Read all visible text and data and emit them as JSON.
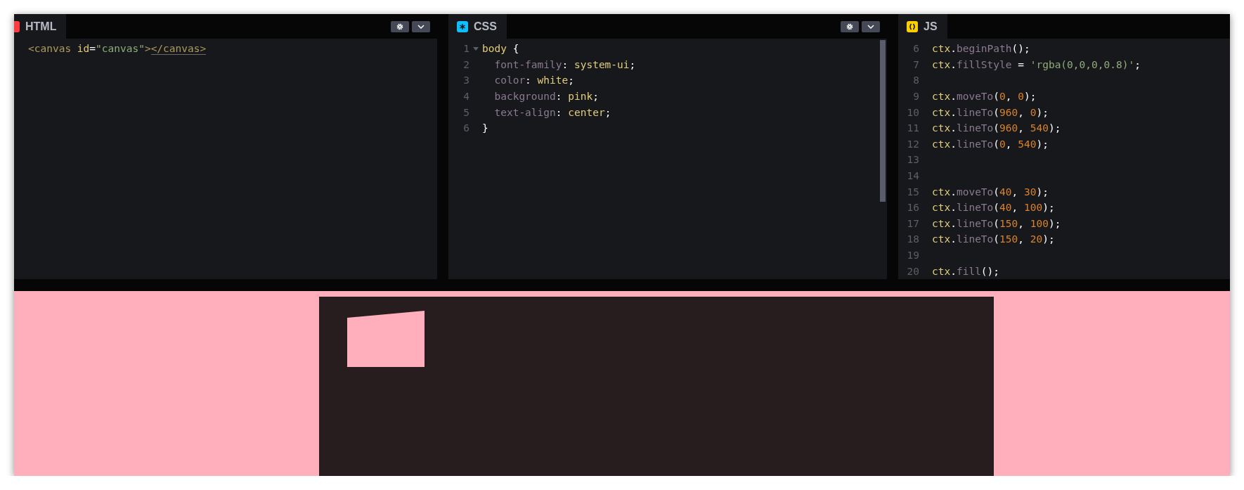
{
  "panels": [
    {
      "tab": {
        "label": "HTML",
        "kind": "html"
      },
      "controls": true,
      "scrollbar": false,
      "lines": [
        {
          "tokens": [
            {
              "text": "<canvas",
              "kind": "tag"
            },
            {
              "text": " id",
              "kind": "attr"
            },
            {
              "text": "=",
              "kind": "punc"
            },
            {
              "text": "\"canvas\"",
              "kind": "string"
            },
            {
              "text": ">",
              "kind": "tag"
            },
            {
              "text": "</canvas>",
              "kind": "tag",
              "matched": true
            }
          ]
        }
      ]
    },
    {
      "tab": {
        "label": "CSS",
        "kind": "css"
      },
      "controls": true,
      "scrollbar": true,
      "lines": [
        {
          "number": "1",
          "foldable": true,
          "tokens": [
            {
              "text": "body",
              "kind": "value"
            },
            {
              "text": " {",
              "kind": "punc"
            }
          ]
        },
        {
          "number": "2",
          "tokens": [
            {
              "text": "  font-family",
              "kind": "prop"
            },
            {
              "text": ": ",
              "kind": "punc"
            },
            {
              "text": "system-ui",
              "kind": "value"
            },
            {
              "text": ";",
              "kind": "punc"
            }
          ]
        },
        {
          "number": "3",
          "tokens": [
            {
              "text": "  color",
              "kind": "prop"
            },
            {
              "text": ": ",
              "kind": "punc"
            },
            {
              "text": "white",
              "kind": "value"
            },
            {
              "text": ";",
              "kind": "punc"
            }
          ]
        },
        {
          "number": "4",
          "tokens": [
            {
              "text": "  background",
              "kind": "prop"
            },
            {
              "text": ": ",
              "kind": "punc"
            },
            {
              "text": "pink",
              "kind": "value"
            },
            {
              "text": ";",
              "kind": "punc"
            }
          ]
        },
        {
          "number": "5",
          "tokens": [
            {
              "text": "  text-align",
              "kind": "prop"
            },
            {
              "text": ": ",
              "kind": "punc"
            },
            {
              "text": "center",
              "kind": "value"
            },
            {
              "text": ";",
              "kind": "punc"
            }
          ]
        },
        {
          "number": "6",
          "tokens": [
            {
              "text": "}",
              "kind": "punc"
            }
          ]
        }
      ]
    },
    {
      "tab": {
        "label": "JS",
        "kind": "js"
      },
      "controls": false,
      "scrollbar": false,
      "lines": [
        {
          "number": "6",
          "tokens": [
            {
              "text": "ctx",
              "kind": "value"
            },
            {
              "text": ".",
              "kind": "punc"
            },
            {
              "text": "beginPath",
              "kind": "prop"
            },
            {
              "text": "();",
              "kind": "punc"
            }
          ]
        },
        {
          "number": "7",
          "tokens": [
            {
              "text": "ctx",
              "kind": "value"
            },
            {
              "text": ".",
              "kind": "punc"
            },
            {
              "text": "fillStyle",
              "kind": "prop"
            },
            {
              "text": " = ",
              "kind": "punc"
            },
            {
              "text": "'rgba(0,0,0,0.8)'",
              "kind": "string"
            },
            {
              "text": ";",
              "kind": "punc"
            }
          ]
        },
        {
          "number": "8"
        },
        {
          "number": "9",
          "tokens": [
            {
              "text": "ctx",
              "kind": "value"
            },
            {
              "text": ".",
              "kind": "punc"
            },
            {
              "text": "moveTo",
              "kind": "prop"
            },
            {
              "text": "(",
              "kind": "punc"
            },
            {
              "text": "0",
              "kind": "num"
            },
            {
              "text": ", ",
              "kind": "punc"
            },
            {
              "text": "0",
              "kind": "num"
            },
            {
              "text": ");",
              "kind": "punc"
            }
          ]
        },
        {
          "number": "10",
          "tokens": [
            {
              "text": "ctx",
              "kind": "value"
            },
            {
              "text": ".",
              "kind": "punc"
            },
            {
              "text": "lineTo",
              "kind": "prop"
            },
            {
              "text": "(",
              "kind": "punc"
            },
            {
              "text": "960",
              "kind": "num"
            },
            {
              "text": ", ",
              "kind": "punc"
            },
            {
              "text": "0",
              "kind": "num"
            },
            {
              "text": ");",
              "kind": "punc"
            }
          ]
        },
        {
          "number": "11",
          "tokens": [
            {
              "text": "ctx",
              "kind": "value"
            },
            {
              "text": ".",
              "kind": "punc"
            },
            {
              "text": "lineTo",
              "kind": "prop"
            },
            {
              "text": "(",
              "kind": "punc"
            },
            {
              "text": "960",
              "kind": "num"
            },
            {
              "text": ", ",
              "kind": "punc"
            },
            {
              "text": "540",
              "kind": "num"
            },
            {
              "text": ");",
              "kind": "punc"
            }
          ]
        },
        {
          "number": "12",
          "tokens": [
            {
              "text": "ctx",
              "kind": "value"
            },
            {
              "text": ".",
              "kind": "punc"
            },
            {
              "text": "lineTo",
              "kind": "prop"
            },
            {
              "text": "(",
              "kind": "punc"
            },
            {
              "text": "0",
              "kind": "num"
            },
            {
              "text": ", ",
              "kind": "punc"
            },
            {
              "text": "540",
              "kind": "num"
            },
            {
              "text": ");",
              "kind": "punc"
            }
          ]
        },
        {
          "number": "13"
        },
        {
          "number": "14"
        },
        {
          "number": "15",
          "tokens": [
            {
              "text": "ctx",
              "kind": "value"
            },
            {
              "text": ".",
              "kind": "punc"
            },
            {
              "text": "moveTo",
              "kind": "prop"
            },
            {
              "text": "(",
              "kind": "punc"
            },
            {
              "text": "40",
              "kind": "num"
            },
            {
              "text": ", ",
              "kind": "punc"
            },
            {
              "text": "30",
              "kind": "num"
            },
            {
              "text": ");",
              "kind": "punc"
            }
          ]
        },
        {
          "number": "16",
          "tokens": [
            {
              "text": "ctx",
              "kind": "value"
            },
            {
              "text": ".",
              "kind": "punc"
            },
            {
              "text": "lineTo",
              "kind": "prop"
            },
            {
              "text": "(",
              "kind": "punc"
            },
            {
              "text": "40",
              "kind": "num"
            },
            {
              "text": ", ",
              "kind": "punc"
            },
            {
              "text": "100",
              "kind": "num"
            },
            {
              "text": ");",
              "kind": "punc"
            }
          ]
        },
        {
          "number": "17",
          "tokens": [
            {
              "text": "ctx",
              "kind": "value"
            },
            {
              "text": ".",
              "kind": "punc"
            },
            {
              "text": "lineTo",
              "kind": "prop"
            },
            {
              "text": "(",
              "kind": "punc"
            },
            {
              "text": "150",
              "kind": "num"
            },
            {
              "text": ", ",
              "kind": "punc"
            },
            {
              "text": "100",
              "kind": "num"
            },
            {
              "text": ");",
              "kind": "punc"
            }
          ]
        },
        {
          "number": "18",
          "tokens": [
            {
              "text": "ctx",
              "kind": "value"
            },
            {
              "text": ".",
              "kind": "punc"
            },
            {
              "text": "lineTo",
              "kind": "prop"
            },
            {
              "text": "(",
              "kind": "punc"
            },
            {
              "text": "150",
              "kind": "num"
            },
            {
              "text": ", ",
              "kind": "punc"
            },
            {
              "text": "20",
              "kind": "num"
            },
            {
              "text": ");",
              "kind": "punc"
            }
          ]
        },
        {
          "number": "19"
        },
        {
          "number": "20",
          "tokens": [
            {
              "text": "ctx",
              "kind": "value"
            },
            {
              "text": ".",
              "kind": "punc"
            },
            {
              "text": "fill",
              "kind": "prop"
            },
            {
              "text": "();",
              "kind": "punc"
            }
          ]
        }
      ]
    }
  ]
}
